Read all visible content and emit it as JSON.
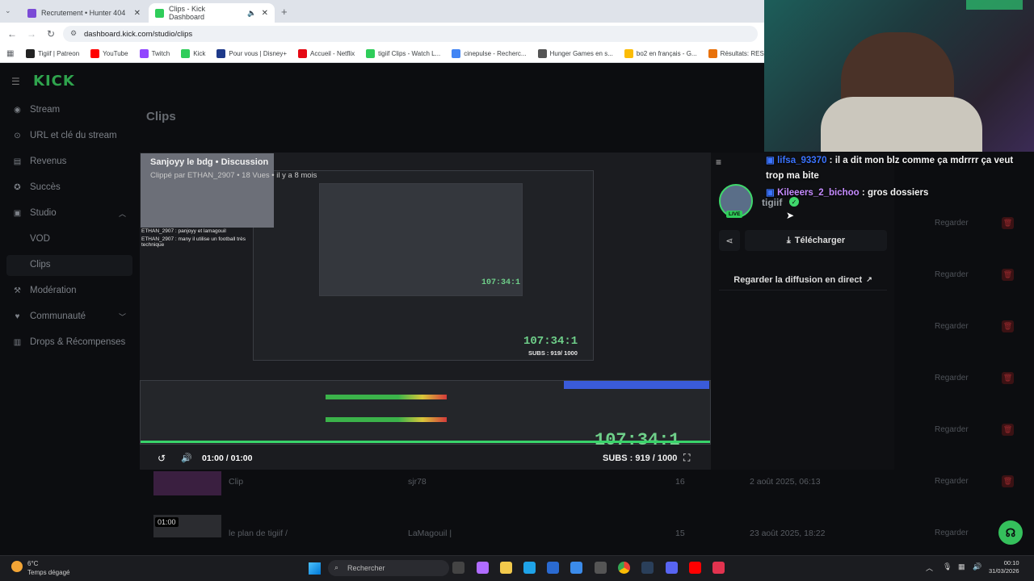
{
  "browser": {
    "tabs": [
      {
        "label": "Recrutement • Hunter 404",
        "color": "#7b4bd6"
      },
      {
        "label": "Clips - Kick Dashboard",
        "color": "#2fcd5a"
      }
    ],
    "url": "dashboard.kick.com/studio/clips",
    "bookmarks": [
      "Tigiif | Patreon",
      "YouTube",
      "Twitch",
      "Kick",
      "Pour vous | Disney+",
      "Accueil - Netflix",
      "tigiif Clips - Watch L...",
      "cinepulse - Recherc...",
      "Hunger Games en s...",
      "bo2 en français - G...",
      "Résultats: RESIDENT"
    ]
  },
  "sidebar": {
    "logo": "KICK",
    "items": [
      {
        "label": "Stream",
        "icon": "stream-icon"
      },
      {
        "label": "URL et clé du stream",
        "icon": "link-icon"
      },
      {
        "label": "Revenus",
        "icon": "revenue-icon"
      },
      {
        "label": "Succès",
        "icon": "trophy-icon"
      },
      {
        "label": "Studio",
        "icon": "studio-icon"
      },
      {
        "label": "VOD",
        "icon": ""
      },
      {
        "label": "Clips",
        "icon": ""
      },
      {
        "label": "Modération",
        "icon": "moderation-icon"
      },
      {
        "label": "Communauté",
        "icon": "community-icon"
      },
      {
        "label": "Drops & Récompenses",
        "icon": "gift-icon"
      }
    ]
  },
  "main": {
    "title": "Clips",
    "row_action": "Regarder",
    "rows": [
      {
        "duration": "",
        "title": "Clip",
        "author": "sjr78",
        "views": "16",
        "date": "2 août 2025, 06:13"
      },
      {
        "duration": "01:00",
        "title": "le plan de tigiif /",
        "author": "LaMagouil |",
        "views": "15",
        "date": "23 août 2025, 18:22"
      }
    ]
  },
  "modal": {
    "clip_title": "Sanjoyy le bdg • Discussion",
    "clip_meta": "Clippé par ETHAN_2907 • 18 Vues • il y a 8 mois",
    "overlay_chat": [
      "ETHAN_2907 : panjoyy et lamagouil",
      "ETHAN_2907 : many il utilise un football très technique"
    ],
    "timer_large": "107:34:1",
    "timer_small": "107:34:1",
    "subs": "SUBS : 919 / 1000",
    "subs_small": "SUBS : 919/ 1000",
    "time": "01:00 / 01:00",
    "progress": 1.0,
    "channel": "tigiif",
    "live_badge": "LIVE",
    "download_label": "Télécharger",
    "watch_live_label": "Regarder la diffusion en direct"
  },
  "stream_chat": [
    {
      "user": "lifsa_93370",
      "message": " : il a dit mon blz comme ça mdrrrr ça veut trop ma bite"
    },
    {
      "user": "Kileeers_2_bichoo",
      "message": " : gros dossiers"
    }
  ],
  "taskbar": {
    "weather_temp": "6°C",
    "weather_text": "Temps dégagé",
    "search_placeholder": "Rechercher",
    "time": "00:10",
    "date": "31/03/2026"
  }
}
